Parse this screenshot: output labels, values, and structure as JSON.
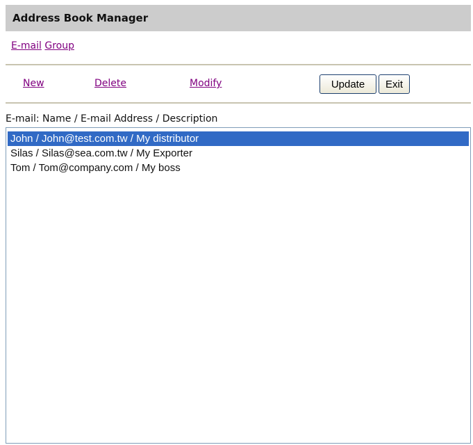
{
  "title": "Address Book Manager",
  "tabs": [
    "E-mail",
    "Group"
  ],
  "actions": {
    "new": "New",
    "delete": "Delete",
    "modify": "Modify",
    "update": "Update",
    "exit": "Exit"
  },
  "list_label": "E-mail: Name / E-mail Address / Description",
  "items": [
    "John / John@test.com.tw / My distributor",
    "Silas / Silas@sea.com.tw / My Exporter",
    "Tom / Tom@company.com / My boss"
  ],
  "selected_index": 0
}
